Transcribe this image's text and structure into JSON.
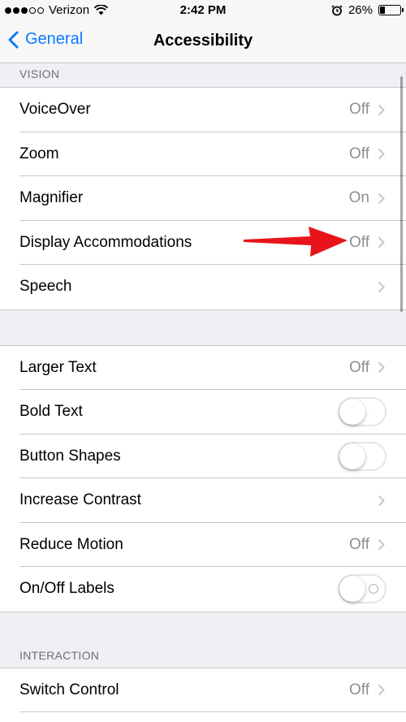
{
  "status_bar": {
    "carrier": "Verizon",
    "signal_dots_filled": 3,
    "signal_dots_total": 5,
    "time": "2:42 PM",
    "battery": "26%",
    "battery_level": 0.26
  },
  "nav": {
    "back_label": "General",
    "title": "Accessibility"
  },
  "sections": [
    {
      "header": "VISION",
      "rows": [
        {
          "label": "VoiceOver",
          "value": "Off",
          "type": "disclosure"
        },
        {
          "label": "Zoom",
          "value": "Off",
          "type": "disclosure"
        },
        {
          "label": "Magnifier",
          "value": "On",
          "type": "disclosure"
        },
        {
          "label": "Display Accommodations",
          "value": "Off",
          "type": "disclosure"
        },
        {
          "label": "Speech",
          "value": "",
          "type": "disclosure"
        }
      ]
    },
    {
      "header": "",
      "rows": [
        {
          "label": "Larger Text",
          "value": "Off",
          "type": "disclosure"
        },
        {
          "label": "Bold Text",
          "value": "",
          "type": "toggle",
          "on": false
        },
        {
          "label": "Button Shapes",
          "value": "",
          "type": "toggle",
          "on": false
        },
        {
          "label": "Increase Contrast",
          "value": "",
          "type": "disclosure"
        },
        {
          "label": "Reduce Motion",
          "value": "Off",
          "type": "disclosure"
        },
        {
          "label": "On/Off Labels",
          "value": "",
          "type": "toggle",
          "on": false,
          "labels": true
        }
      ]
    },
    {
      "header": "INTERACTION",
      "rows": [
        {
          "label": "Switch Control",
          "value": "Off",
          "type": "disclosure"
        }
      ]
    }
  ],
  "colors": {
    "accent": "#0a7aff",
    "annotation_arrow": "#e8141b",
    "background": "#efeff4",
    "secondary_text": "#8e8e93"
  }
}
